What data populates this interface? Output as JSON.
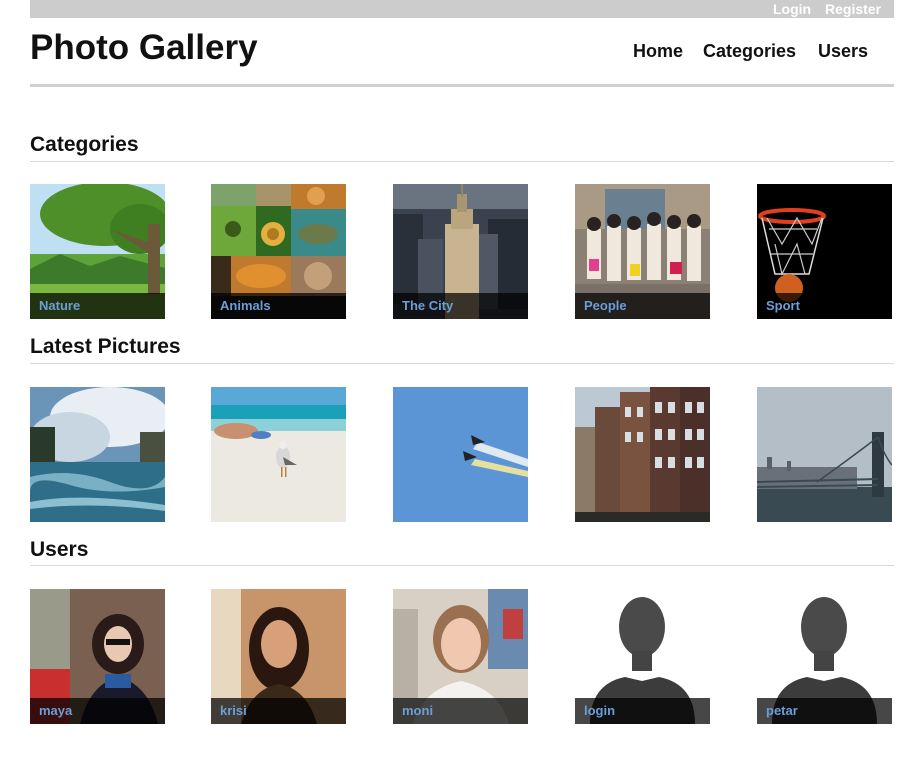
{
  "header": {
    "login_label": "Login",
    "register_label": "Register",
    "site_title": "Photo Gallery",
    "nav": [
      "Home",
      "Categories",
      "Users"
    ]
  },
  "sections": {
    "categories": {
      "title": "Categories",
      "items": [
        "Nature",
        "Animals",
        "The City",
        "People",
        "Sport"
      ]
    },
    "latest": {
      "title": "Latest Pictures",
      "items": [
        "waterfall-photo",
        "beach-seagull-photo",
        "airshow-jets-photo",
        "canal-houses-photo",
        "bridge-skyline-photo"
      ]
    },
    "users": {
      "title": "Users",
      "items": [
        "maya",
        "krisi",
        "moni",
        "login",
        "petar"
      ]
    }
  },
  "colors": {
    "topbar": "#cccccc",
    "caption_text": "#6b9fd6",
    "caption_bg": "#000000b8"
  }
}
